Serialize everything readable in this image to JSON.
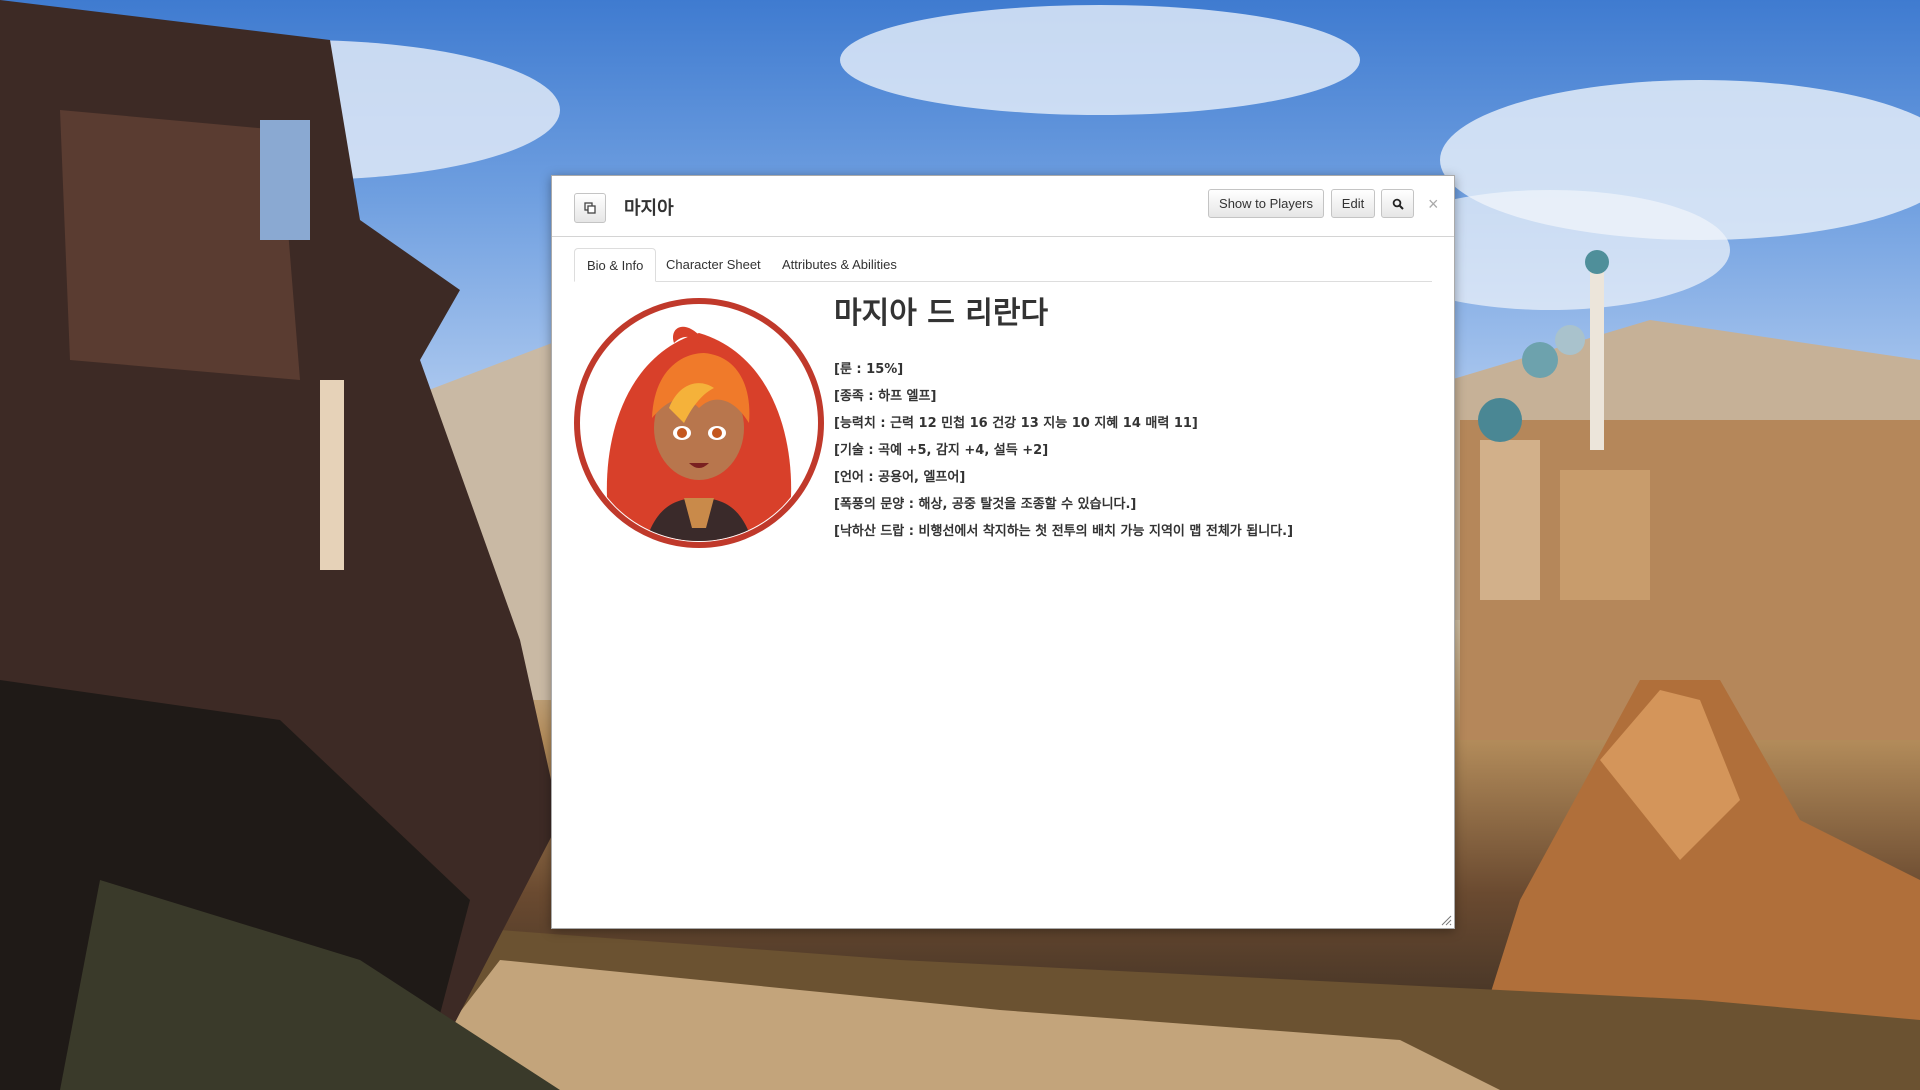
{
  "dialog": {
    "title": "마지아",
    "buttons": {
      "show_to_players": "Show to Players",
      "edit": "Edit"
    },
    "close_glyph": "×",
    "icons": {
      "popout": "popout-icon",
      "search": "search-icon",
      "close": "close-icon",
      "resize": "resize-grip-icon"
    }
  },
  "tabs": [
    {
      "label": "Bio & Info",
      "active": true
    },
    {
      "label": "Character Sheet",
      "active": false
    },
    {
      "label": "Attributes & Abilities",
      "active": false
    }
  ],
  "bio": {
    "name": "마지아 드 리란다",
    "lines": [
      "[룬 : 15%]",
      "[종족 : 하프 엘프]",
      "[능력치 : 근력 12 민첩 16 건강 13 지능 10 지혜 14 매력 11]",
      "[기술 : 곡예 +5, 감지 +4, 설득 +2]",
      "[언어 : 공용어, 엘프어]",
      "[폭풍의 문양 : 해상, 공중 탈것을 조종할 수 있습니다.]",
      "[낙하산 드랍 : 비행선에서 착지하는 첫 전투의 배치 가능 지역이 맵 전체가 됩니다.]"
    ]
  },
  "colors": {
    "portrait_ring": "#c0392b",
    "hair": "#e04a2a",
    "text": "#333333"
  }
}
